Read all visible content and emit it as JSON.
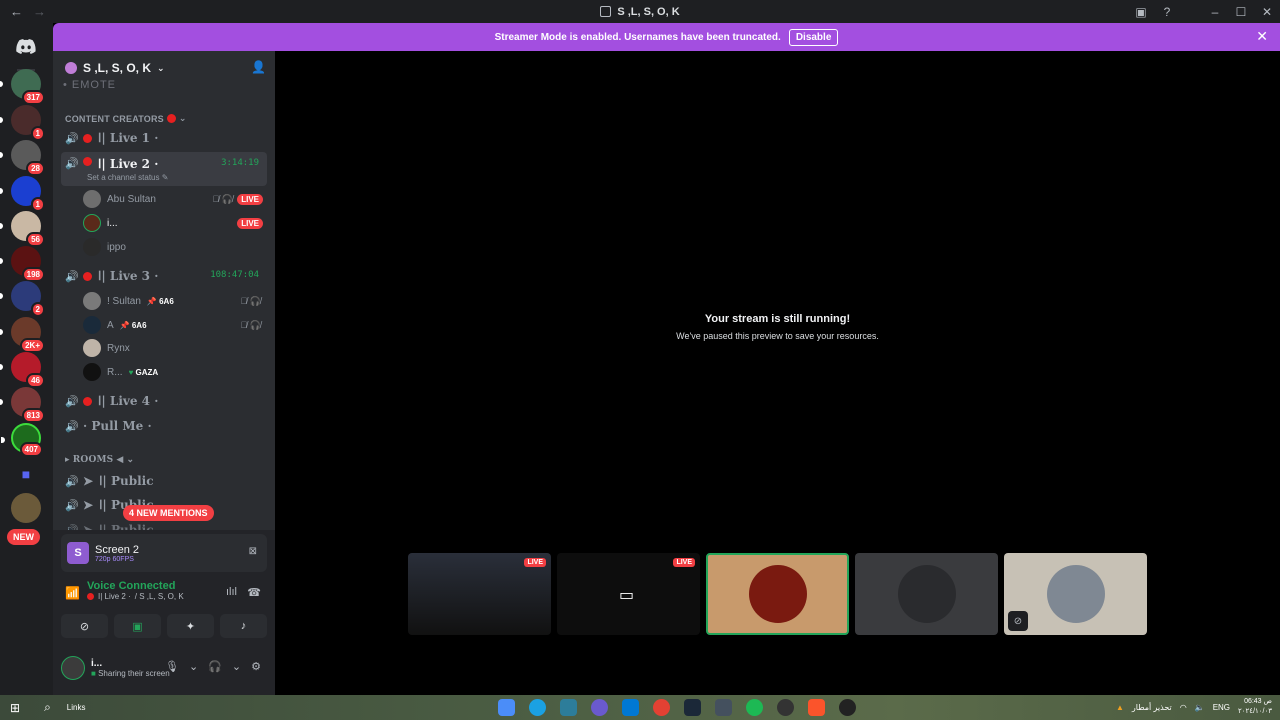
{
  "titlebar": {
    "title": "S ,L, S, O, K",
    "back": "←",
    "forward": "→"
  },
  "banner": {
    "text": "Streamer Mode is enabled. Usernames have been truncated.",
    "disable_label": "Disable"
  },
  "guilds": {
    "badges": [
      "317",
      "1",
      "28",
      "1",
      "56",
      "198",
      "2",
      "2K+",
      "46",
      "813",
      "407"
    ],
    "new_label": "NEW"
  },
  "server": {
    "name": "S ,L, S, O, K",
    "cut_row": "• EMOTE"
  },
  "category_content": "CONTENT CREATORS",
  "category_rooms": "ROOMS",
  "channels": {
    "live1": "ا| Live 1 ·",
    "live2": "ا| Live 2 ·",
    "live2_timer": "3:14:19",
    "live2_status": "Set a channel status",
    "live3": "ا| Live 3 ·",
    "live3_timer": "108:47:04",
    "live4": "ا| Live 4 ·",
    "pull": "· Pull Me ·",
    "public1": "ا| Public",
    "public2": "ا| Public",
    "public3": "ا| Public"
  },
  "users": {
    "abu": "Abu Sultan",
    "i": "i...",
    "ippo": "ippo",
    "sultan": "! Sultan",
    "sultan_role": "6A6",
    "a": "A",
    "a_role": "6A6",
    "rynx": "Rynx",
    "r": "R...",
    "r_role": "GAZA",
    "live": "LIVE"
  },
  "mentions": "4 NEW MENTIONS",
  "panel": {
    "screen_title": "Screen 2",
    "screen_sub": "720p 60FPS",
    "voice_connected": "Voice Connected",
    "voice_channel": "ا| Live 2 ·",
    "voice_server": "/ S ,L, S, O, K",
    "user_name": "i...",
    "user_status": "Sharing their screen"
  },
  "stream": {
    "heading": "Your stream is still running!",
    "sub": "We've paused this preview to save your resources."
  },
  "thumbs": {
    "live1": "LIVE",
    "live2": "LIVE"
  },
  "taskbar": {
    "links": "Links",
    "weather": "تحذير أمطار",
    "lang": "ENG",
    "time": "06:43 ص",
    "date": "٢٠٢٤/١٠/٠٣"
  },
  "colors": {
    "accent": "#a34fe0",
    "green": "#23a55a",
    "red": "#f23f43"
  }
}
